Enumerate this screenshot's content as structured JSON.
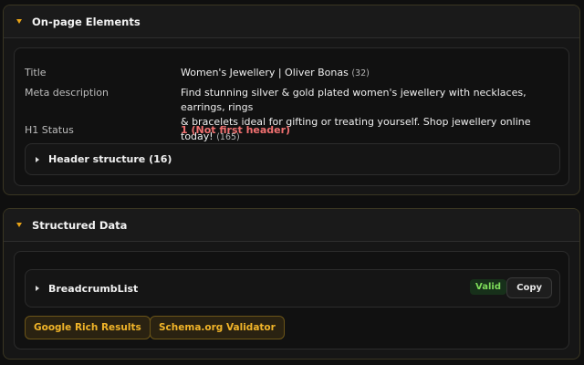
{
  "onpage": {
    "title": "On-page Elements",
    "rows": [
      {
        "label": "Title",
        "value": "Women's Jewellery | Oliver Bonas",
        "count": "(32)"
      },
      {
        "label": "Meta description",
        "value_line1": "Find stunning silver & gold plated women's jewellery with necklaces, earrings, rings",
        "value_line2": "& bracelets ideal for gifting or treating yourself. Shop jewellery online today!",
        "count": "(165)"
      },
      {
        "label": "H1 Status",
        "value": "1 (Not first header)"
      }
    ],
    "header_structure": "Header structure (16)"
  },
  "structured": {
    "title": "Structured Data",
    "item": "BreadcrumbList",
    "badge": "Valid",
    "copy": "Copy",
    "buttons": [
      "Google Rich Results",
      "Schema.org Validator"
    ]
  },
  "colors": {
    "accent": "#e8a317",
    "warn": "#f07070",
    "valid": "#7ddc5a"
  }
}
